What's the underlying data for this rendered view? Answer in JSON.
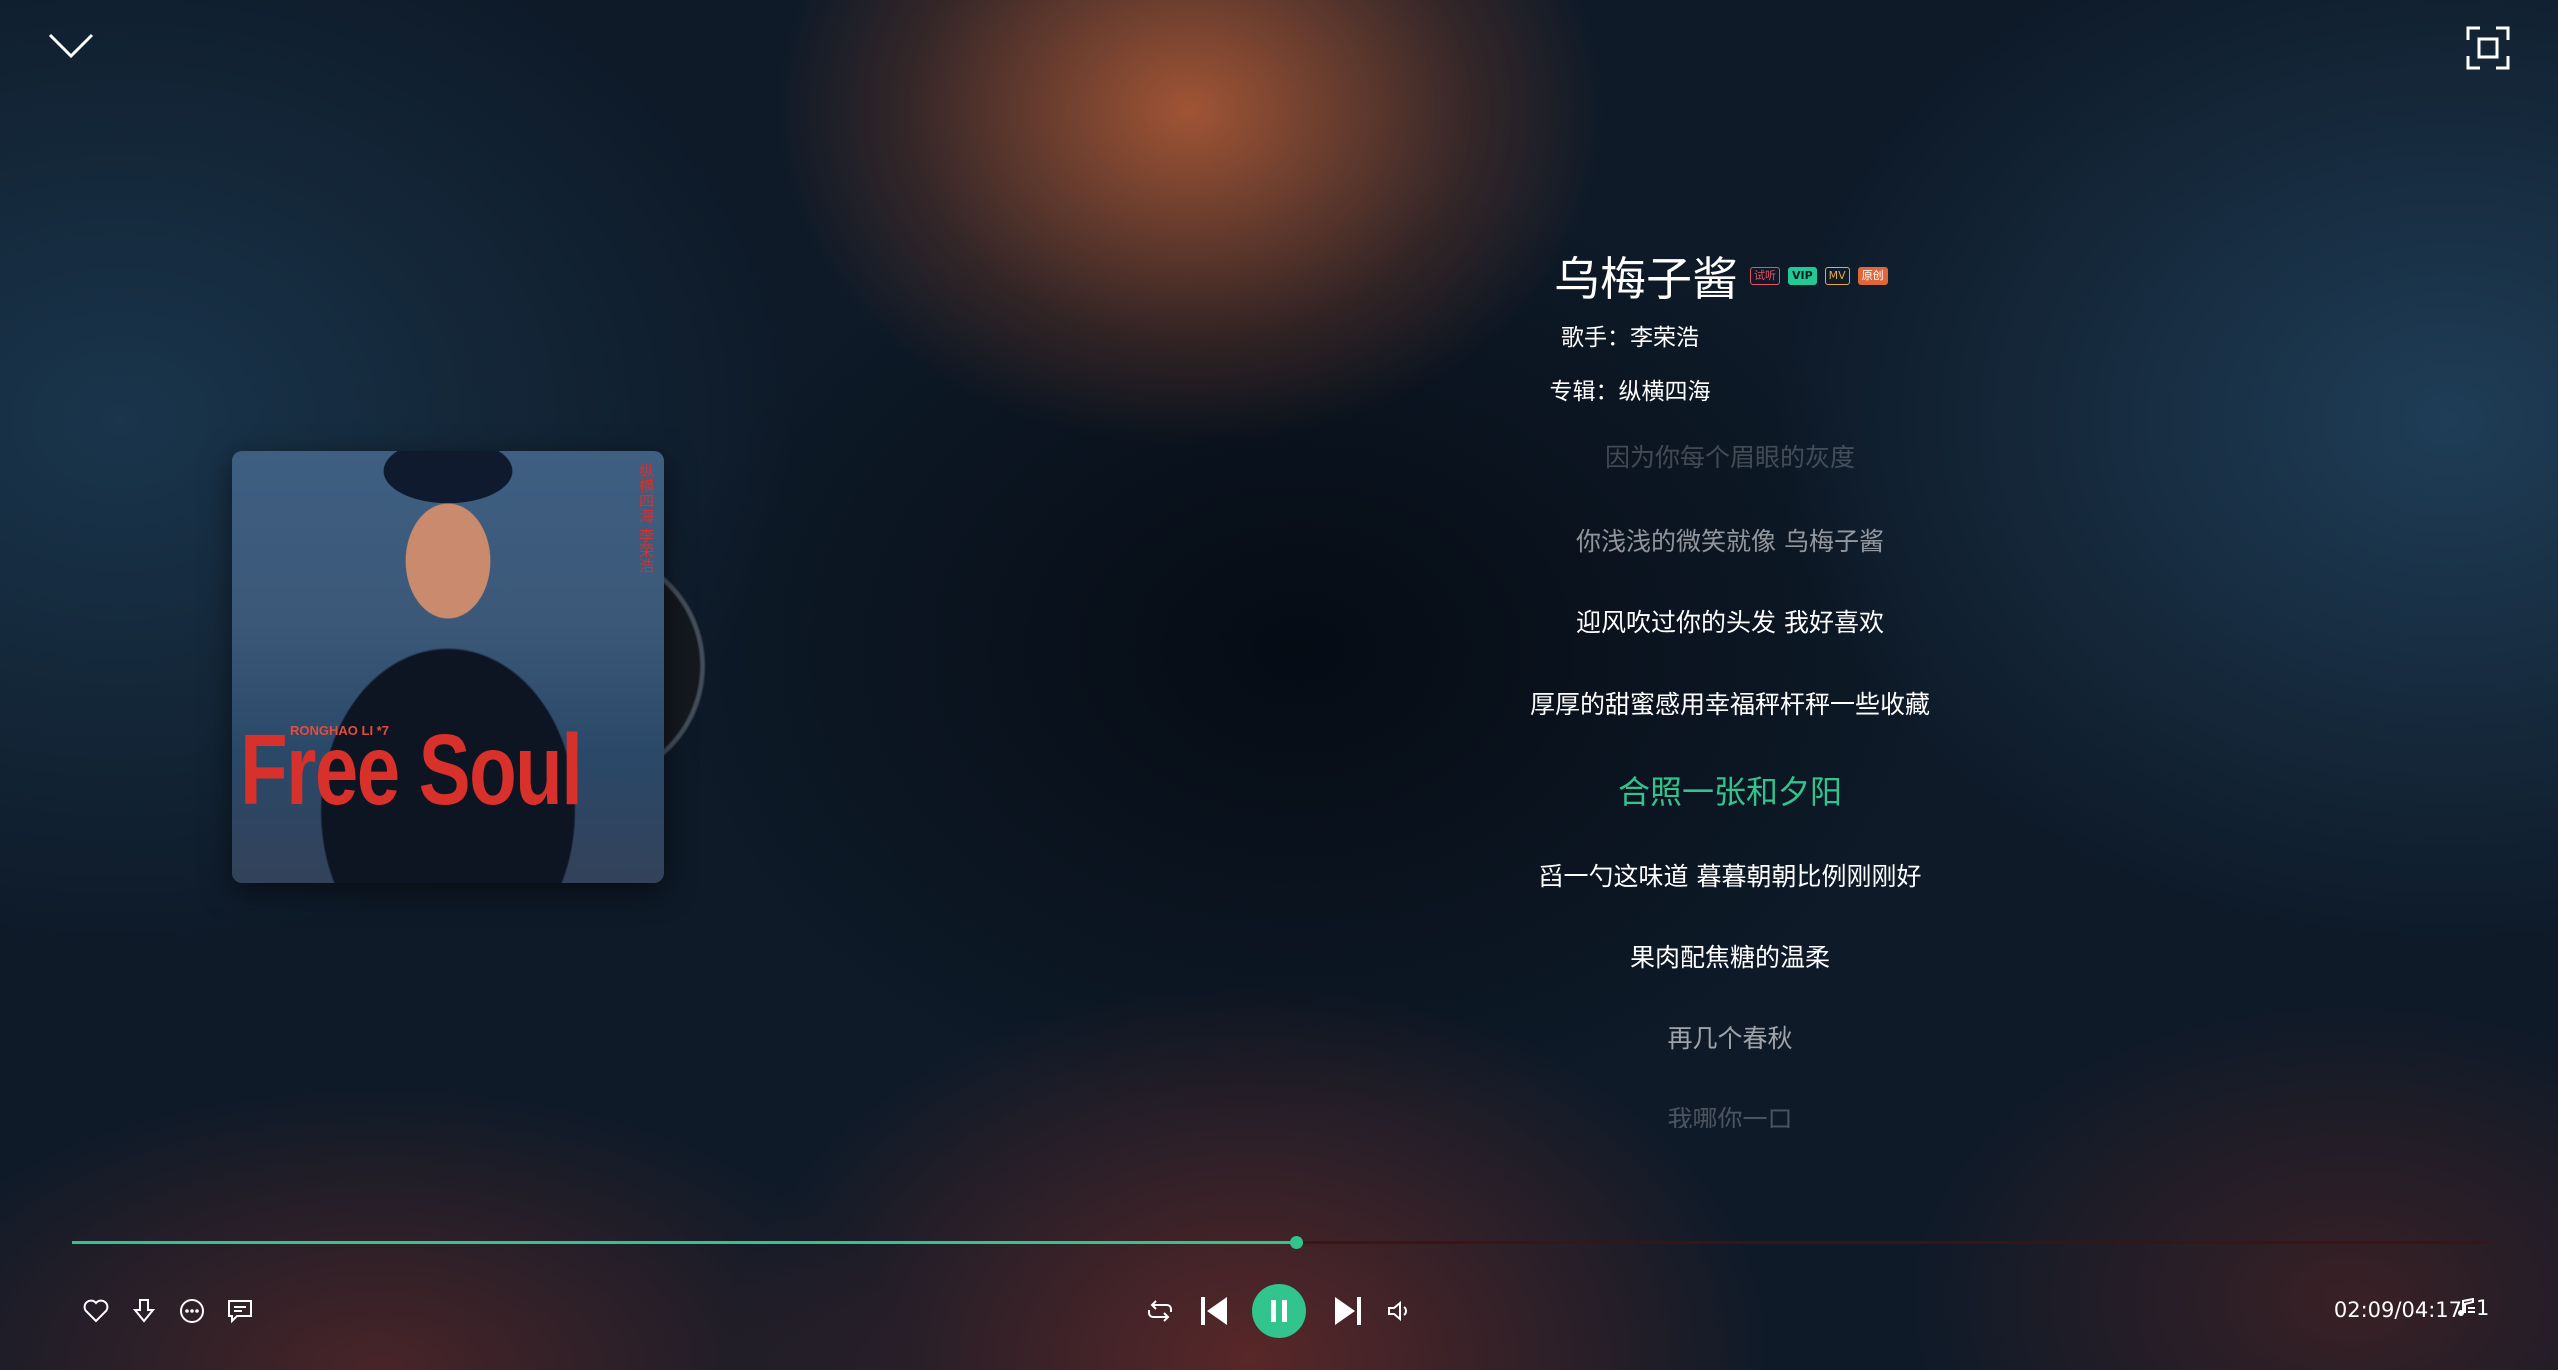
{
  "song": {
    "title": "乌梅子酱",
    "badges": [
      "试听",
      "VIP",
      "MV",
      "原创"
    ],
    "singer_line": "歌手：李荣浩",
    "album_line": "专辑：纵横四海"
  },
  "cover": {
    "title": "Free Soul",
    "artist_line": "RONGHAO LI *7",
    "side_text": "纵横四海 李荣浩"
  },
  "lyrics": [
    "因为你每个眉眼的灰度",
    "你浅浅的微笑就像 乌梅子酱",
    "迎风吹过你的头发 我好喜欢",
    "厚厚的甜蜜感用幸福秤杆秤一些收藏",
    "合照一张和夕阳",
    "舀一勺这味道 暮暮朝朝比例刚刚好",
    "果肉配焦糖的温柔",
    "再几个春秋",
    "我哪你一口"
  ],
  "current_lyric_index": 4,
  "playback": {
    "time_text": "02:09/04:17",
    "progress": 0.506,
    "queue_count": "1"
  },
  "colors": {
    "accent": "#31c48d"
  },
  "icons": {
    "collapse": "chevron-down-icon",
    "fullscreen": "fullscreen-icon",
    "like": "heart-icon",
    "download": "download-icon",
    "more": "more-icon",
    "comment": "comment-icon",
    "loop": "loop-icon",
    "prev": "previous-icon",
    "pause": "pause-icon",
    "next": "next-icon",
    "volume": "volume-icon",
    "playlist": "playlist-icon"
  }
}
